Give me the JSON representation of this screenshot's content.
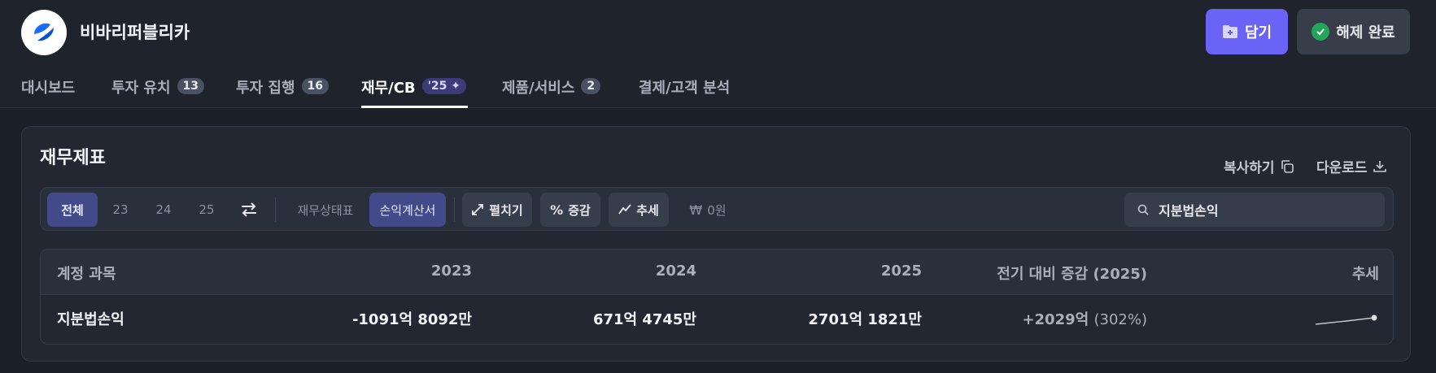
{
  "app": {
    "title": "비바리퍼블리카"
  },
  "header": {
    "save_label": "담기",
    "done_label": "해제 완료"
  },
  "tabs": [
    {
      "label": "대시보드",
      "badge": ""
    },
    {
      "label": "투자 유치",
      "badge": "13"
    },
    {
      "label": "투자 집행",
      "badge": "16"
    },
    {
      "label": "재무/CB",
      "badge": "'25",
      "active": true
    },
    {
      "label": "제품/서비스",
      "badge": "2"
    },
    {
      "label": "결제/고객 분석",
      "badge": ""
    }
  ],
  "card": {
    "title": "재무제표",
    "copy_label": "복사하기",
    "download_label": "다운로드"
  },
  "toolbar": {
    "years": [
      "전체",
      "23",
      "24",
      "25"
    ],
    "statements": [
      "재무상태표",
      "손익계산서"
    ],
    "expand_label": "펼치기",
    "change_label": "증감",
    "trend_label": "추세",
    "zero_label": "0원",
    "search_value": "지분법손익"
  },
  "table": {
    "headers": [
      "계정 과목",
      "2023",
      "2024",
      "2025",
      "전기 대비 증감 (2025)",
      "추세"
    ],
    "rows": [
      {
        "account": "지분법손익",
        "y2023": "-1091억 8092만",
        "y2024": "671억 4745만",
        "y2025": "2701억 1821만",
        "change": "+2029억",
        "change_pct": "(302%)"
      }
    ]
  },
  "colors": {
    "accent": "#6b63f5",
    "success": "#22a55a",
    "selected": "#434a8a"
  }
}
